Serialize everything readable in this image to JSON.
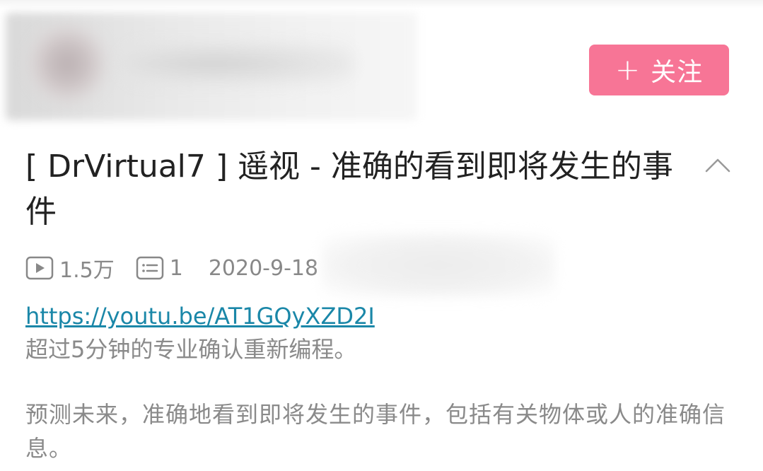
{
  "uploader": {
    "follow_label": "关注",
    "follow_icon": "plus-icon",
    "follow_color": "#f77596"
  },
  "video": {
    "title": "[ DrVirtual7 ] 遥视 - 准确的看到即将发生的事件",
    "collapse_icon": "chevron-up-icon",
    "stats": {
      "views_icon": "play-icon",
      "views": "1.5万",
      "comments_icon": "comment-icon",
      "comments": "1",
      "date": "2020-9-18"
    }
  },
  "description": {
    "link": "https://youtu.be/AT1GQyXZD2I",
    "line1": "超过5分钟的专业确认重新编程。",
    "paragraph": "预测未来，准确地看到即将发生的事件，包括有关物体或人的准确信息。",
    "link_color": "#1a87a8"
  }
}
